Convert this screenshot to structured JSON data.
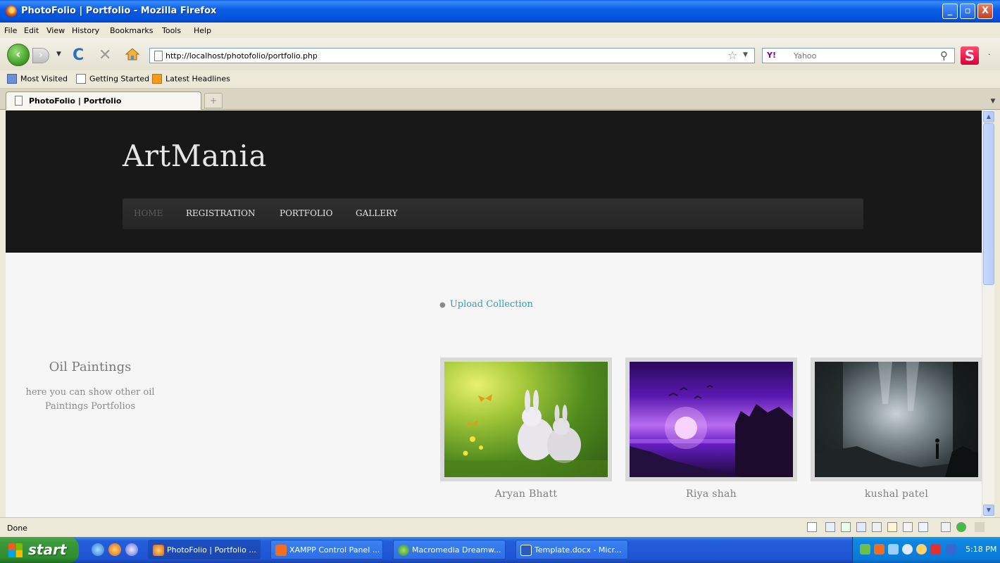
{
  "window": {
    "title": "PhotoFolio | Portfolio - Mozilla Firefox",
    "buttons": [
      "_",
      "▫",
      "X"
    ]
  },
  "menu": [
    "File",
    "Edit",
    "View",
    "History",
    "Bookmarks",
    "Tools",
    "Help"
  ],
  "toolbar": {
    "url": "http://localhost/photofolio/portfolio.php",
    "search_engine": "Y!",
    "search_placeholder": "Yahoo"
  },
  "bookmarks": [
    "Most Visited",
    "Getting Started",
    "Latest Headlines"
  ],
  "tabs": [
    {
      "label": "PhotoFolio | Portfolio"
    }
  ],
  "newtab_label": "+",
  "page": {
    "logo": "ArtMania",
    "nav": [
      "HOME",
      "REGISTRATION",
      "PORTFOLIO",
      "GALLERY"
    ],
    "upload_link": "Upload Collection",
    "sidebar": {
      "title": "Oil Paintings",
      "description": "here you can show other oil Paintings Portfolios"
    },
    "artists": [
      {
        "name": "Aryan Bhatt",
        "image": "bunnies-meadow"
      },
      {
        "name": "Riya shah",
        "image": "purple-fantasy-sunset"
      },
      {
        "name": "kushal patel",
        "image": "misty-forest-figure"
      }
    ]
  },
  "status": "Done",
  "taskbar": {
    "start": "start",
    "tasks": [
      "PhotoFolio | Portfolio ...",
      "XAMPP Control Panel ...",
      "Macromedia Dreamw...",
      "Template.docx - Micr..."
    ],
    "clock": "5:18 PM"
  }
}
